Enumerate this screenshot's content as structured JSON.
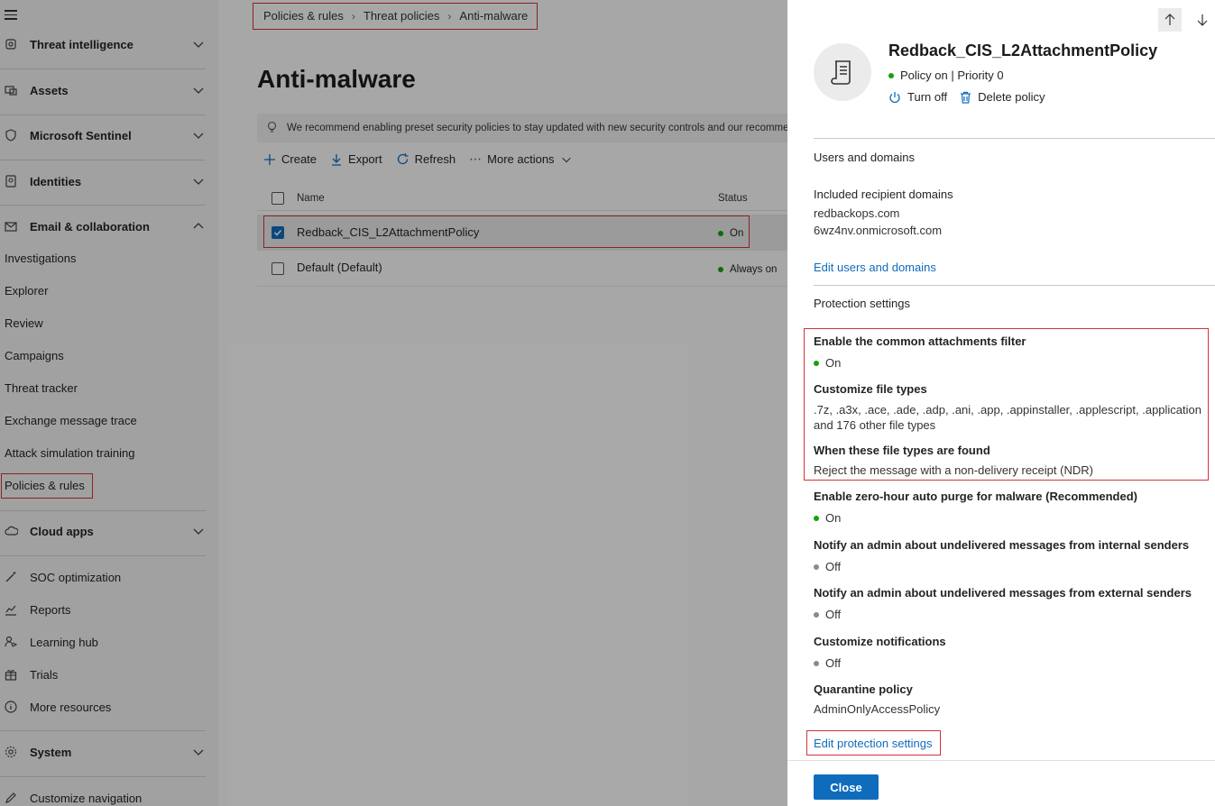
{
  "sidebar": {
    "groups": [
      {
        "label": "Threat intelligence",
        "icon": "threat-intel-icon"
      },
      {
        "label": "Assets",
        "icon": "assets-icon"
      },
      {
        "label": "Microsoft Sentinel",
        "icon": "sentinel-icon"
      },
      {
        "label": "Identities",
        "icon": "identities-icon"
      },
      {
        "label": "Email & collaboration",
        "icon": "mail-icon"
      }
    ],
    "email_items": [
      "Investigations",
      "Explorer",
      "Review",
      "Campaigns",
      "Threat tracker",
      "Exchange message trace",
      "Attack simulation training",
      "Policies & rules"
    ],
    "cloud_apps": "Cloud apps",
    "bottom_items": [
      "SOC optimization",
      "Reports",
      "Learning hub",
      "Trials",
      "More resources"
    ],
    "system": "System",
    "customize": "Customize navigation"
  },
  "breadcrumb": [
    "Policies & rules",
    "Threat policies",
    "Anti-malware"
  ],
  "page_title": "Anti-malware",
  "banner": "We recommend enabling preset security policies to stay updated with new security controls and our recommended s",
  "toolbar": {
    "create": "Create",
    "export": "Export",
    "refresh": "Refresh",
    "more": "More actions"
  },
  "table": {
    "headers": {
      "name": "Name",
      "status": "Status"
    },
    "rows": [
      {
        "name": "Redback_CIS_L2AttachmentPolicy",
        "status": "On",
        "selected": true
      },
      {
        "name": "Default (Default)",
        "status": "Always on",
        "selected": false
      }
    ]
  },
  "panel": {
    "title": "Redback_CIS_L2AttachmentPolicy",
    "status": "Policy on | Priority 0",
    "turn_off": "Turn off",
    "delete": "Delete policy",
    "users_domains_head": "Users and domains",
    "included_domains_head": "Included recipient domains",
    "domains": [
      "redbackops.com",
      "6wz4nv.onmicrosoft.com"
    ],
    "edit_users": "Edit users and domains",
    "protection_head": "Protection settings",
    "settings": [
      {
        "label": "Enable the common attachments filter",
        "value": "On",
        "color": "#13a10e"
      },
      {
        "label": "Customize file types",
        "text": ".7z, .a3x, .ace, .ade, .adp, .ani, .app, .appinstaller, .applescript, .application and 176 other file types"
      },
      {
        "label": "When these file types are found",
        "text": "Reject the message with a non-delivery receipt (NDR)"
      },
      {
        "label": "Enable zero-hour auto purge for malware (Recommended)",
        "value": "On",
        "color": "#13a10e"
      },
      {
        "label": "Notify an admin about undelivered messages from internal senders",
        "value": "Off",
        "color": "#8a8a8a"
      },
      {
        "label": "Notify an admin about undelivered messages from external senders",
        "value": "Off",
        "color": "#8a8a8a"
      },
      {
        "label": "Customize notifications",
        "value": "Off",
        "color": "#8a8a8a"
      },
      {
        "label": "Quarantine policy",
        "text": "AdminOnlyAccessPolicy"
      }
    ],
    "edit_protection": "Edit protection settings",
    "close": "Close"
  },
  "colors": {
    "accent": "#0f6cbd",
    "highlight": "#d13438",
    "on": "#13a10e",
    "off": "#8a8a8a"
  }
}
